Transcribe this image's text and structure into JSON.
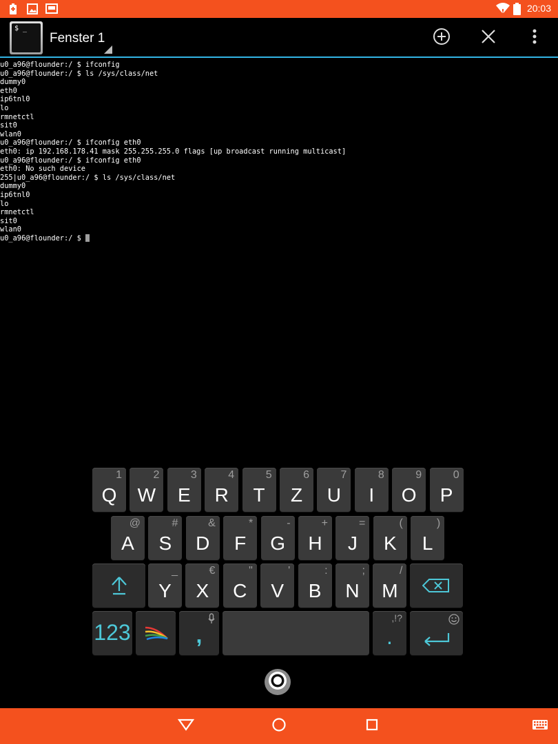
{
  "status_bar": {
    "time": "20:03",
    "icons": [
      "battery-saver-icon",
      "image-notification-icon",
      "screen-notification-icon",
      "wifi-icon",
      "battery-icon"
    ]
  },
  "action_bar": {
    "app_icon_prompt": "$ _",
    "window_title": "Fenster 1",
    "buttons": [
      "new-window-icon",
      "close-window-icon",
      "overflow-menu-icon"
    ]
  },
  "terminal": {
    "lines": [
      "u0_a96@flounder:/ $ ifconfig",
      "u0_a96@flounder:/ $ ls /sys/class/net",
      "dummy0",
      "eth0",
      "ip6tnl0",
      "lo",
      "rmnetctl",
      "sit0",
      "wlan0",
      "u0_a96@flounder:/ $ ifconfig eth0",
      "eth0: ip 192.168.178.41 mask 255.255.255.0 flags [up broadcast running multicast]",
      "u0_a96@flounder:/ $ ifconfig eth0",
      "eth0: No such device",
      "255|u0_a96@flounder:/ $ ls /sys/class/net",
      "dummy0",
      "ip6tnl0",
      "lo",
      "rmnetctl",
      "sit0",
      "wlan0"
    ],
    "prompt": "u0_a96@flounder:/ $ "
  },
  "keyboard": {
    "row1": [
      {
        "main": "Q",
        "sub": "1"
      },
      {
        "main": "W",
        "sub": "2"
      },
      {
        "main": "E",
        "sub": "3"
      },
      {
        "main": "R",
        "sub": "4"
      },
      {
        "main": "T",
        "sub": "5"
      },
      {
        "main": "Z",
        "sub": "6"
      },
      {
        "main": "U",
        "sub": "7"
      },
      {
        "main": "I",
        "sub": "8"
      },
      {
        "main": "O",
        "sub": "9"
      },
      {
        "main": "P",
        "sub": "0"
      }
    ],
    "row2": [
      {
        "main": "A",
        "sub": "@"
      },
      {
        "main": "S",
        "sub": "#"
      },
      {
        "main": "D",
        "sub": "&"
      },
      {
        "main": "F",
        "sub": "*"
      },
      {
        "main": "G",
        "sub": "-"
      },
      {
        "main": "H",
        "sub": "+"
      },
      {
        "main": "J",
        "sub": "="
      },
      {
        "main": "K",
        "sub": "("
      },
      {
        "main": "L",
        "sub": ")"
      }
    ],
    "row3": [
      {
        "main": "Y",
        "sub": "_"
      },
      {
        "main": "X",
        "sub": "€"
      },
      {
        "main": "C",
        "sub": "\""
      },
      {
        "main": "V",
        "sub": "'"
      },
      {
        "main": "B",
        "sub": ":"
      },
      {
        "main": "N",
        "sub": ";"
      },
      {
        "main": "M",
        "sub": "/"
      }
    ],
    "numbers_label": "123",
    "comma": ",",
    "period": ".",
    "period_sub": ",!?"
  },
  "colors": {
    "accent": "#f4511e",
    "divider": "#33b5e5",
    "key_accent": "#4dc8d8"
  }
}
